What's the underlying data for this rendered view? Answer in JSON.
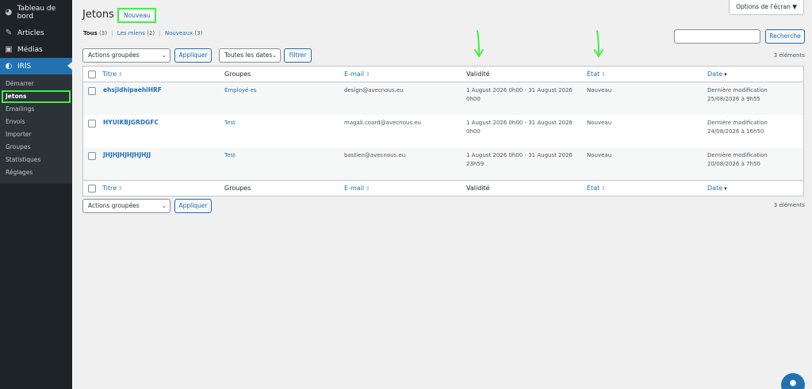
{
  "sidebar": {
    "top_items": [
      {
        "label": "Tableau de bord",
        "icon": "dashboard-icon"
      },
      {
        "label": "Articles",
        "icon": "pin-icon"
      },
      {
        "label": "Médias",
        "icon": "media-icon"
      },
      {
        "label": "IRIS",
        "icon": "iris-icon"
      }
    ],
    "sub_items": [
      "Démarrer",
      "Jetons",
      "Emailings",
      "Envois",
      "Importer",
      "Groupes",
      "Statistiques",
      "Réglages"
    ]
  },
  "header": {
    "title": "Jetons",
    "add_new": "Nouveau",
    "screen_options": "Options de l’écran ▼"
  },
  "views": {
    "all": {
      "label": "Tous",
      "count": "(3)"
    },
    "mine": {
      "label": "Les miens",
      "count": "(2)"
    },
    "new": {
      "label": "Nouveaux",
      "count": "(3)"
    }
  },
  "search": {
    "button": "Recherche",
    "value": ""
  },
  "tablenav": {
    "bulk_actions": "Actions groupées",
    "apply": "Appliquer",
    "dates": "Toutes les dates",
    "filter": "Filtrer",
    "count": "3 éléments"
  },
  "table": {
    "headers": {
      "title": "Titre",
      "groups": "Groupes",
      "email": "E-mail",
      "validity": "Validité",
      "state": "État",
      "date": "Date"
    },
    "rows": [
      {
        "title": "ehsjidhipaehiHRF",
        "group": "Employé·es",
        "email": "design@avecnous.eu",
        "validity_1": "1 August 2026 0h00 - 31 August 2026",
        "validity_2": "0h00",
        "state": "Nouveau",
        "date_1": "Dernière modification",
        "date_2": "25/08/2026 à 9h55"
      },
      {
        "title": "HYUIKBJGRDGFC",
        "group": "Test",
        "email": "magali.coard@avecnous.eu",
        "validity_1": "1 August 2026 0h00 - 31 August 2026",
        "validity_2": "0h00",
        "state": "Nouveau",
        "date_1": "Dernière modification",
        "date_2": "24/08/2026 à 16h50"
      },
      {
        "title": "JHJHJHJHJHJHJJ",
        "group": "Test",
        "email": "bastien@avecnous.eu",
        "validity_1": "1 August 2026 0h00 - 31 August 2026",
        "validity_2": "23h59",
        "state": "Nouveau",
        "date_1": "Dernière modification",
        "date_2": "20/08/2026 à 7h50"
      }
    ]
  },
  "colors": {
    "accent": "#2271b1",
    "highlight": "#3df33d",
    "sidebar": "#1d2327"
  }
}
